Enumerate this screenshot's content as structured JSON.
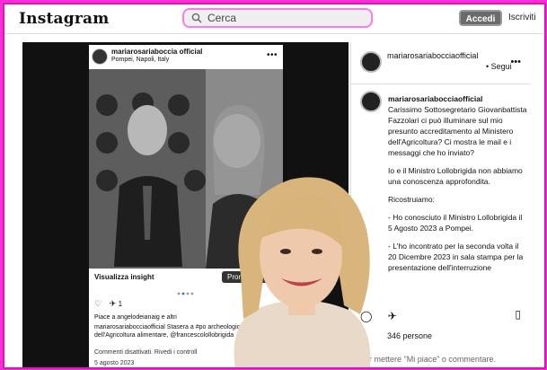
{
  "app": {
    "logo": "Instagram"
  },
  "search": {
    "placeholder": "Cerca"
  },
  "auth": {
    "login_label": "Accedi",
    "signup_label": "Iscriviti"
  },
  "post": {
    "account": "mariarosariaboccia official",
    "account_display": "mariarosariabocciaofficial",
    "location": "Pompei, Napoli, Italy",
    "insight_label": "Visualizza insight",
    "promote_label": "Prom",
    "likes_text": "Piace a angelodeianaig e altri",
    "caption": "mariarosariabocciaofficial Stasera a #po archeologico, il Ministro dell'Agricoltura alimentare, @francescolollobrigida , il Mi",
    "comments_disabled": "Commenti disattivati. Rivedi i controll",
    "date": "5 agosto 2023",
    "comment_count": "1"
  },
  "panel": {
    "account": "mariarosariabocciaofficial",
    "follow_label": "• Segui",
    "comment_author": "mariarosariabocciaofficial",
    "comment_paragraphs": [
      "Carissimo Sottosegretario Giovanbattista Fazzolari ci può illuminare sul mio presunto accreditamento al Ministero dell'Agricoltura? Ci mostra le mail e i messaggi che ho inviato?",
      "Io e il Ministro Lollobrigida non abbiamo una conoscenza approfondita.",
      "Ricostruiamo:",
      "- Ho conosciuto il Ministro Lollobrigida il 5 Agosto 2023 a Pompei.",
      "- L'ho incontrato per la seconda volta il 20 Dicembre 2023 in sala stampa per la presentazione dell'interruzione"
    ],
    "people_text": "346 persone",
    "add_comment_placeholder": "per mettere \"Mi piace\" o commentare."
  }
}
